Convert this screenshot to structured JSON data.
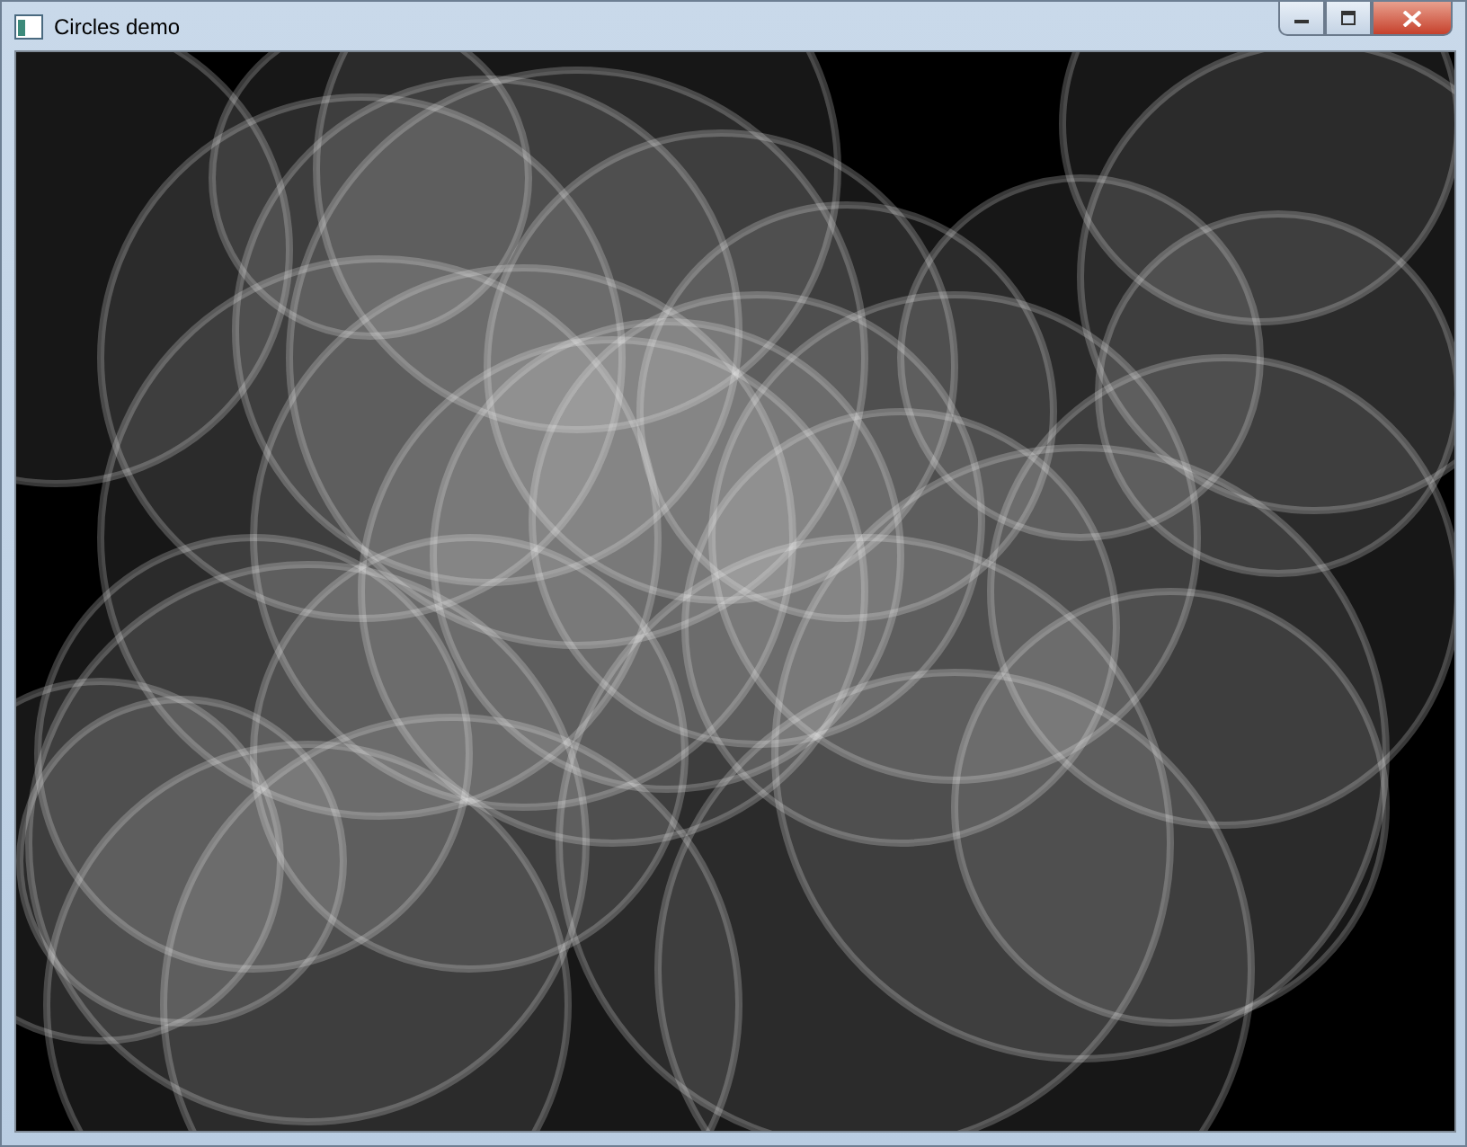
{
  "window": {
    "title": "Circles demo"
  }
}
